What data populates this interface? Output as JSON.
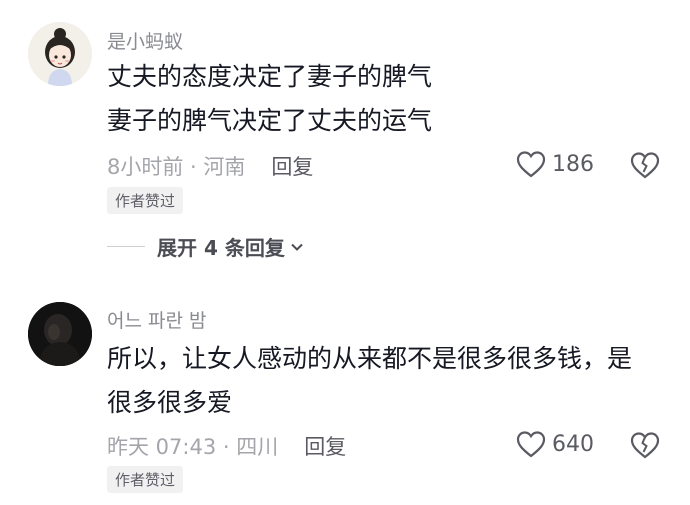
{
  "comments": [
    {
      "username": "是小蚂蚁",
      "lines": [
        "丈夫的态度决定了妻子的脾气",
        "妻子的脾气决定了丈夫的运气"
      ],
      "time_location": "8小时前 · 河南",
      "reply_label": "回复",
      "likes": "186",
      "badge": "作者赞过",
      "expand_label": "展开 4 条回复",
      "avatar": "cartoon-girl-avatar"
    },
    {
      "username": "어느 파란 밤",
      "lines": [
        "所以，让女人感动的从来都不是很多很多钱，是",
        "很多很多爱"
      ],
      "time_location": "昨天 07:43 · 四川",
      "reply_label": "回复",
      "likes": "640",
      "badge": "作者赞过",
      "avatar": "dark-photo-avatar"
    }
  ],
  "colors": {
    "text": "#161823",
    "muted": "#a4a5aa",
    "badge_bg": "#f1f1f2"
  }
}
